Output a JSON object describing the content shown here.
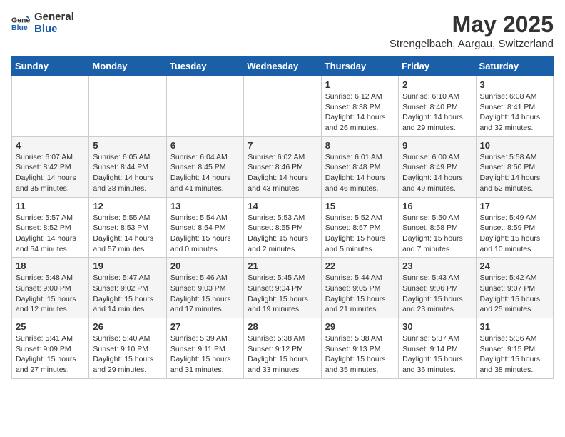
{
  "logo": {
    "text_general": "General",
    "text_blue": "Blue"
  },
  "title": "May 2025",
  "subtitle": "Strengelbach, Aargau, Switzerland",
  "weekdays": [
    "Sunday",
    "Monday",
    "Tuesday",
    "Wednesday",
    "Thursday",
    "Friday",
    "Saturday"
  ],
  "weeks": [
    [
      {
        "day": "",
        "info": ""
      },
      {
        "day": "",
        "info": ""
      },
      {
        "day": "",
        "info": ""
      },
      {
        "day": "",
        "info": ""
      },
      {
        "day": "1",
        "info": "Sunrise: 6:12 AM\nSunset: 8:38 PM\nDaylight: 14 hours and 26 minutes."
      },
      {
        "day": "2",
        "info": "Sunrise: 6:10 AM\nSunset: 8:40 PM\nDaylight: 14 hours and 29 minutes."
      },
      {
        "day": "3",
        "info": "Sunrise: 6:08 AM\nSunset: 8:41 PM\nDaylight: 14 hours and 32 minutes."
      }
    ],
    [
      {
        "day": "4",
        "info": "Sunrise: 6:07 AM\nSunset: 8:42 PM\nDaylight: 14 hours and 35 minutes."
      },
      {
        "day": "5",
        "info": "Sunrise: 6:05 AM\nSunset: 8:44 PM\nDaylight: 14 hours and 38 minutes."
      },
      {
        "day": "6",
        "info": "Sunrise: 6:04 AM\nSunset: 8:45 PM\nDaylight: 14 hours and 41 minutes."
      },
      {
        "day": "7",
        "info": "Sunrise: 6:02 AM\nSunset: 8:46 PM\nDaylight: 14 hours and 43 minutes."
      },
      {
        "day": "8",
        "info": "Sunrise: 6:01 AM\nSunset: 8:48 PM\nDaylight: 14 hours and 46 minutes."
      },
      {
        "day": "9",
        "info": "Sunrise: 6:00 AM\nSunset: 8:49 PM\nDaylight: 14 hours and 49 minutes."
      },
      {
        "day": "10",
        "info": "Sunrise: 5:58 AM\nSunset: 8:50 PM\nDaylight: 14 hours and 52 minutes."
      }
    ],
    [
      {
        "day": "11",
        "info": "Sunrise: 5:57 AM\nSunset: 8:52 PM\nDaylight: 14 hours and 54 minutes."
      },
      {
        "day": "12",
        "info": "Sunrise: 5:55 AM\nSunset: 8:53 PM\nDaylight: 14 hours and 57 minutes."
      },
      {
        "day": "13",
        "info": "Sunrise: 5:54 AM\nSunset: 8:54 PM\nDaylight: 15 hours and 0 minutes."
      },
      {
        "day": "14",
        "info": "Sunrise: 5:53 AM\nSunset: 8:55 PM\nDaylight: 15 hours and 2 minutes."
      },
      {
        "day": "15",
        "info": "Sunrise: 5:52 AM\nSunset: 8:57 PM\nDaylight: 15 hours and 5 minutes."
      },
      {
        "day": "16",
        "info": "Sunrise: 5:50 AM\nSunset: 8:58 PM\nDaylight: 15 hours and 7 minutes."
      },
      {
        "day": "17",
        "info": "Sunrise: 5:49 AM\nSunset: 8:59 PM\nDaylight: 15 hours and 10 minutes."
      }
    ],
    [
      {
        "day": "18",
        "info": "Sunrise: 5:48 AM\nSunset: 9:00 PM\nDaylight: 15 hours and 12 minutes."
      },
      {
        "day": "19",
        "info": "Sunrise: 5:47 AM\nSunset: 9:02 PM\nDaylight: 15 hours and 14 minutes."
      },
      {
        "day": "20",
        "info": "Sunrise: 5:46 AM\nSunset: 9:03 PM\nDaylight: 15 hours and 17 minutes."
      },
      {
        "day": "21",
        "info": "Sunrise: 5:45 AM\nSunset: 9:04 PM\nDaylight: 15 hours and 19 minutes."
      },
      {
        "day": "22",
        "info": "Sunrise: 5:44 AM\nSunset: 9:05 PM\nDaylight: 15 hours and 21 minutes."
      },
      {
        "day": "23",
        "info": "Sunrise: 5:43 AM\nSunset: 9:06 PM\nDaylight: 15 hours and 23 minutes."
      },
      {
        "day": "24",
        "info": "Sunrise: 5:42 AM\nSunset: 9:07 PM\nDaylight: 15 hours and 25 minutes."
      }
    ],
    [
      {
        "day": "25",
        "info": "Sunrise: 5:41 AM\nSunset: 9:09 PM\nDaylight: 15 hours and 27 minutes."
      },
      {
        "day": "26",
        "info": "Sunrise: 5:40 AM\nSunset: 9:10 PM\nDaylight: 15 hours and 29 minutes."
      },
      {
        "day": "27",
        "info": "Sunrise: 5:39 AM\nSunset: 9:11 PM\nDaylight: 15 hours and 31 minutes."
      },
      {
        "day": "28",
        "info": "Sunrise: 5:38 AM\nSunset: 9:12 PM\nDaylight: 15 hours and 33 minutes."
      },
      {
        "day": "29",
        "info": "Sunrise: 5:38 AM\nSunset: 9:13 PM\nDaylight: 15 hours and 35 minutes."
      },
      {
        "day": "30",
        "info": "Sunrise: 5:37 AM\nSunset: 9:14 PM\nDaylight: 15 hours and 36 minutes."
      },
      {
        "day": "31",
        "info": "Sunrise: 5:36 AM\nSunset: 9:15 PM\nDaylight: 15 hours and 38 minutes."
      }
    ]
  ]
}
